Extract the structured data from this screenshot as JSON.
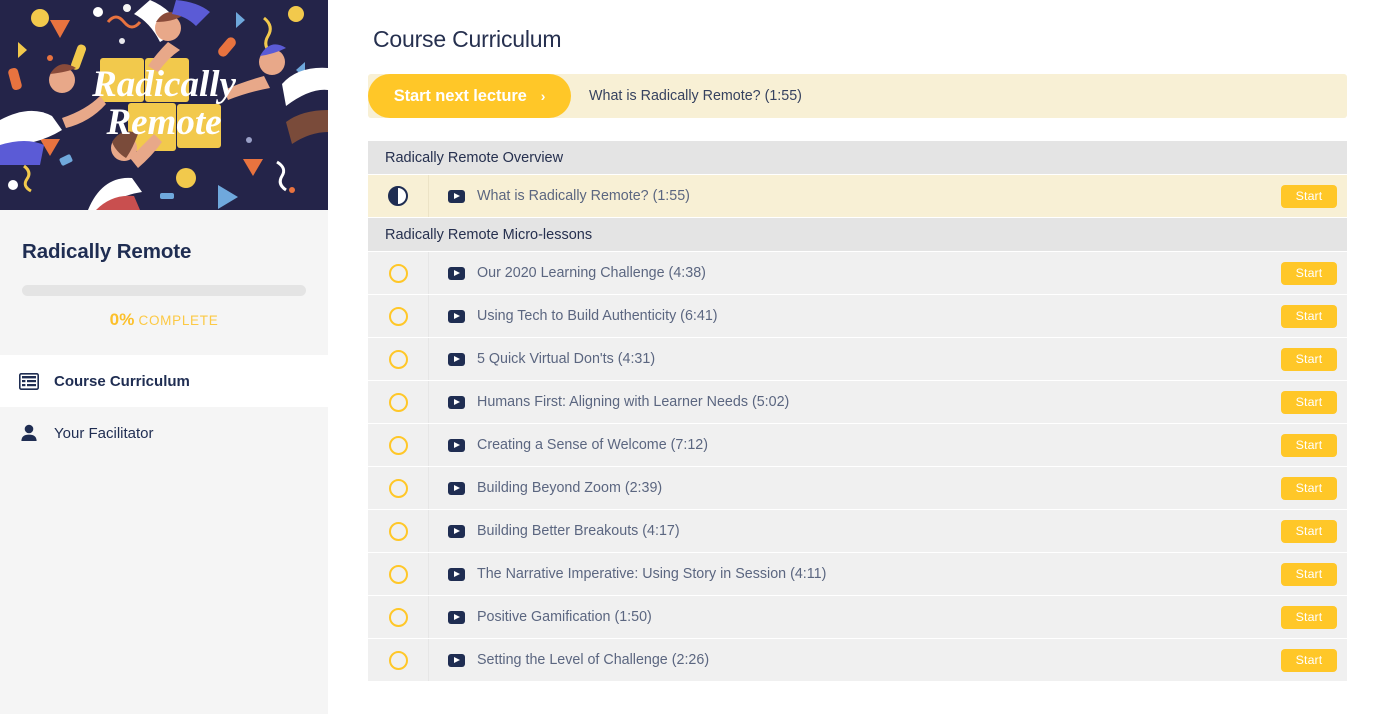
{
  "sidebar": {
    "banner": {
      "icon": "course-banner-illustration",
      "title_line1": "Radically",
      "title_line2": "Remote",
      "bg_color": "#242449",
      "accent_color": "#f2c94c"
    },
    "course_title": "Radically Remote",
    "progress": {
      "percent_value": 0,
      "percent_text": "0%",
      "complete_label": "COMPLETE",
      "bar_color": "#ffc728",
      "track_color": "#e4e4e4"
    },
    "nav_items": [
      {
        "label": "Course Curriculum",
        "icon": "list-icon",
        "active": true
      },
      {
        "label": "Your Facilitator",
        "icon": "person-icon",
        "active": false
      }
    ],
    "scrollbar": {
      "arrow_icon": "scroll-up-arrow-icon"
    }
  },
  "main": {
    "page_title": "Course Curriculum",
    "next_lecture": {
      "button_label": "Start next lecture",
      "chevron": "›",
      "lecture_text": "What is Radically Remote? (1:55)",
      "banner_color": "#f8f0d5",
      "button_color": "#ffc728"
    },
    "sections": [
      {
        "heading": "Radically Remote Overview",
        "lectures": [
          {
            "title": "What is Radically Remote? (1:55)",
            "status": "in-progress",
            "status_icon": "half-circle-icon",
            "media_icon": "video-play-icon",
            "action_label": "Start",
            "highlighted": true
          }
        ]
      },
      {
        "heading": "Radically Remote Micro-lessons",
        "lectures": [
          {
            "title": "Our 2020 Learning Challenge (4:38)",
            "status": "not-started",
            "status_icon": "empty-circle-icon",
            "media_icon": "video-play-icon",
            "action_label": "Start",
            "highlighted": false
          },
          {
            "title": "Using Tech to Build Authenticity (6:41)",
            "status": "not-started",
            "status_icon": "empty-circle-icon",
            "media_icon": "video-play-icon",
            "action_label": "Start",
            "highlighted": false
          },
          {
            "title": "5 Quick Virtual Don'ts (4:31)",
            "status": "not-started",
            "status_icon": "empty-circle-icon",
            "media_icon": "video-play-icon",
            "action_label": "Start",
            "highlighted": false
          },
          {
            "title": "Humans First: Aligning with Learner Needs (5:02)",
            "status": "not-started",
            "status_icon": "empty-circle-icon",
            "media_icon": "video-play-icon",
            "action_label": "Start",
            "highlighted": false
          },
          {
            "title": "Creating a Sense of Welcome (7:12)",
            "status": "not-started",
            "status_icon": "empty-circle-icon",
            "media_icon": "video-play-icon",
            "action_label": "Start",
            "highlighted": false
          },
          {
            "title": "Building Beyond Zoom (2:39)",
            "status": "not-started",
            "status_icon": "empty-circle-icon",
            "media_icon": "video-play-icon",
            "action_label": "Start",
            "highlighted": false
          },
          {
            "title": "Building Better Breakouts (4:17)",
            "status": "not-started",
            "status_icon": "empty-circle-icon",
            "media_icon": "video-play-icon",
            "action_label": "Start",
            "highlighted": false
          },
          {
            "title": "The Narrative Imperative: Using Story in Session (4:11)",
            "status": "not-started",
            "status_icon": "empty-circle-icon",
            "media_icon": "video-play-icon",
            "action_label": "Start",
            "highlighted": false
          },
          {
            "title": "Positive Gamification (1:50)",
            "status": "not-started",
            "status_icon": "empty-circle-icon",
            "media_icon": "video-play-icon",
            "action_label": "Start",
            "highlighted": false
          },
          {
            "title": "Setting the Level of Challenge (2:26)",
            "status": "not-started",
            "status_icon": "empty-circle-icon",
            "media_icon": "video-play-icon",
            "action_label": "Start",
            "highlighted": false
          }
        ]
      }
    ]
  }
}
